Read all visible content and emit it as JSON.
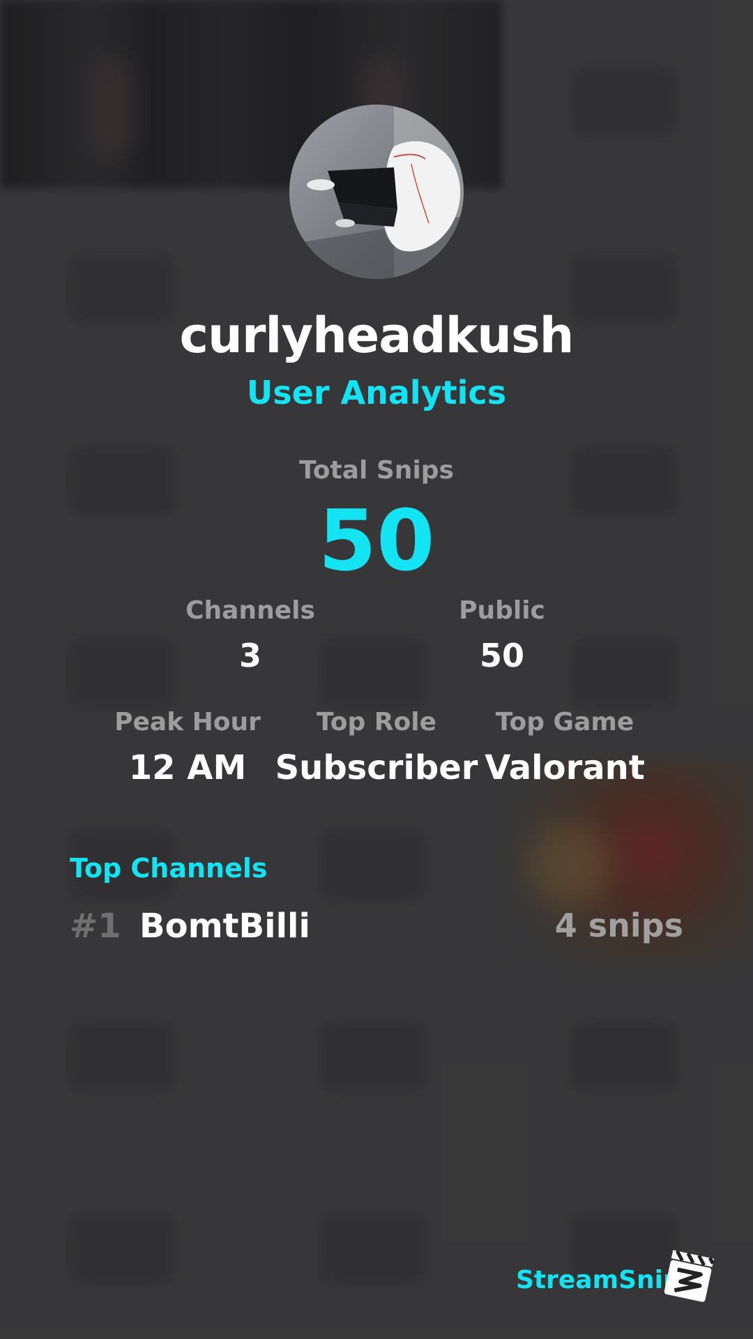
{
  "profile": {
    "username": "curlyheadkush",
    "subtitle": "User Analytics",
    "avatar_icon": "user-avatar-photo"
  },
  "stats": {
    "total_label": "Total Snips",
    "total_value": "50",
    "channels_label": "Channels",
    "channels_value": "3",
    "public_label": "Public",
    "public_value": "50",
    "peak_label": "Peak Hour",
    "peak_value": "12 AM",
    "role_label": "Top Role",
    "role_value": "Subscriber",
    "game_label": "Top Game",
    "game_value": "Valorant"
  },
  "top_channels": {
    "title": "Top Channels",
    "items": [
      {
        "rank": "#1",
        "name": "BomtBilli",
        "count": "4 snips"
      }
    ]
  },
  "brand": {
    "name": "StreamSnip",
    "icon": "clapperboard-icon"
  },
  "colors": {
    "accent": "#14e3f3",
    "background": "#3e3e3f",
    "label": "#9d9d9e",
    "text": "#ffffff"
  }
}
